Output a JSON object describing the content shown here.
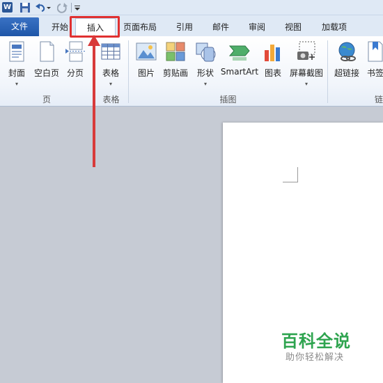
{
  "qat": {
    "logo": "W",
    "icons": [
      "word-logo-icon",
      "save-icon",
      "undo-icon",
      "redo-icon",
      "customize-icon"
    ]
  },
  "tabs": [
    {
      "label": "文件",
      "kind": "file"
    },
    {
      "label": "开始"
    },
    {
      "label": "插入",
      "active": true
    },
    {
      "label": "页面布局"
    },
    {
      "label": "引用"
    },
    {
      "label": "邮件"
    },
    {
      "label": "审阅"
    },
    {
      "label": "视图"
    },
    {
      "label": "加载项"
    }
  ],
  "ribbon": {
    "buttons": {
      "cover": "封面",
      "blank_page": "空白页",
      "page_break": "分页",
      "table": "表格",
      "picture": "图片",
      "clipart": "剪贴画",
      "shapes": "形状",
      "smartart": "SmartArt",
      "chart": "图表",
      "screenshot": "屏幕截图",
      "hyperlink": "超链接",
      "bookmark": "书签"
    },
    "dropdown_glyph": "▾",
    "groups": {
      "pages": "页",
      "tables": "表格",
      "illustrations": "插图",
      "links": "链接"
    }
  },
  "watermark": {
    "title": "百科全说",
    "subtitle": "助你轻松解决"
  },
  "colors": {
    "accent": "#1f56a8",
    "highlight": "#e03030",
    "watermark": "#2ea44f"
  }
}
